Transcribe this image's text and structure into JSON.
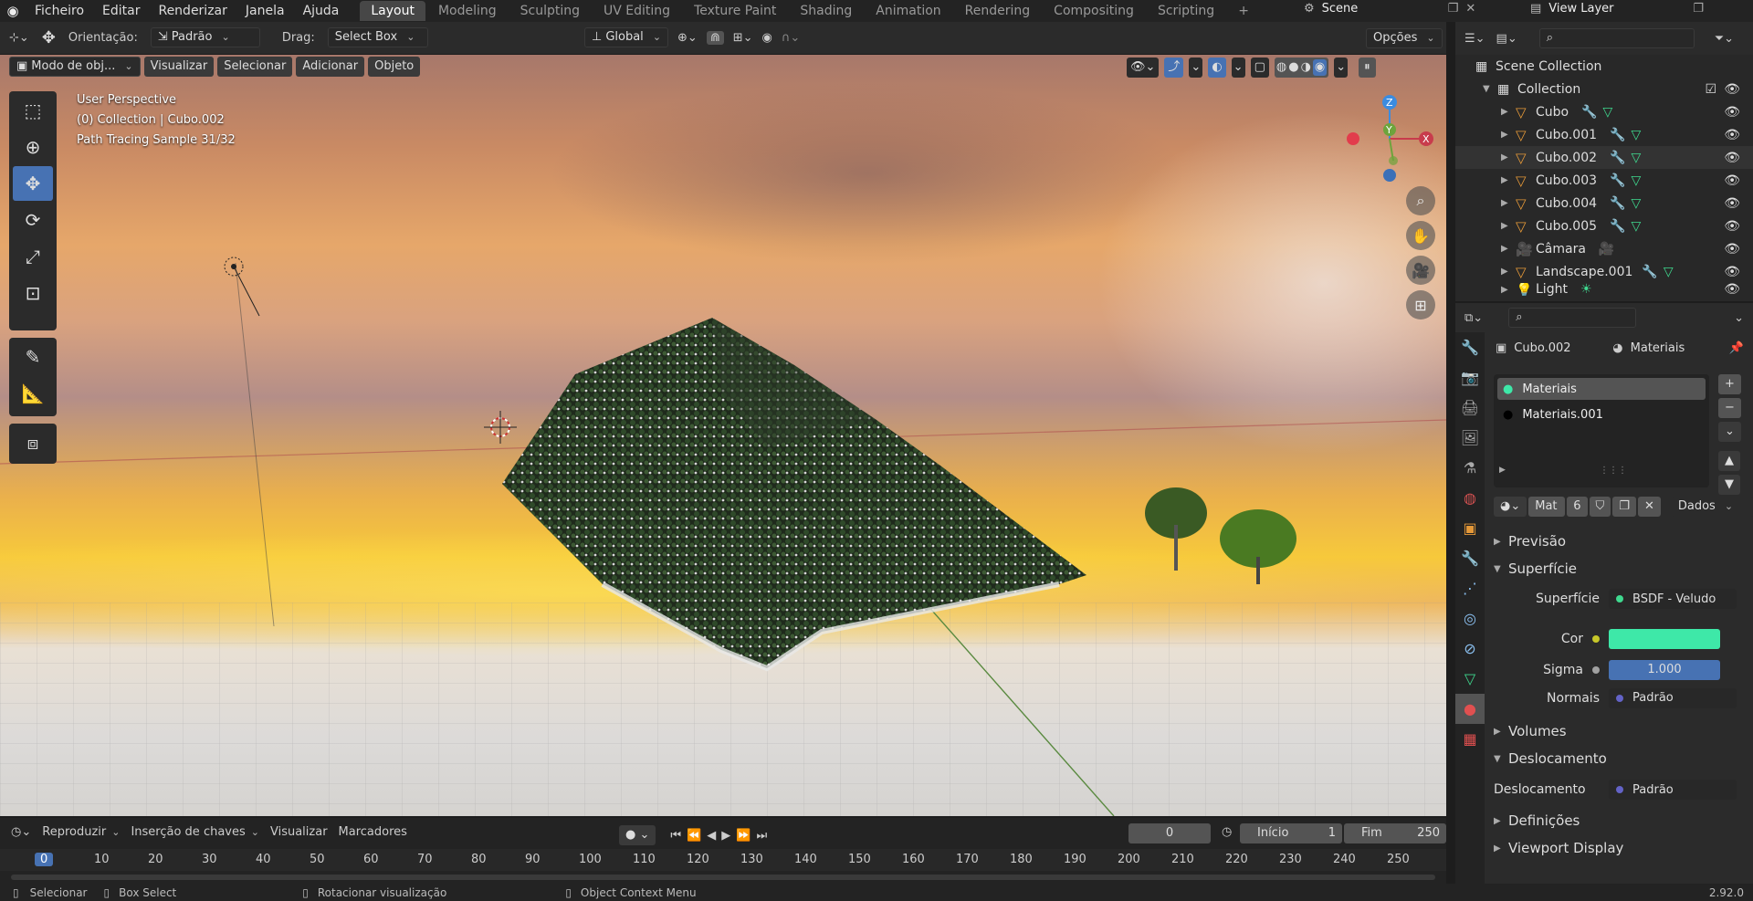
{
  "topbar": {
    "menus": [
      "Ficheiro",
      "Editar",
      "Renderizar",
      "Janela",
      "Ajuda"
    ],
    "workspaces": [
      "Layout",
      "Modeling",
      "Sculpting",
      "UV Editing",
      "Texture Paint",
      "Shading",
      "Animation",
      "Rendering",
      "Compositing",
      "Scripting"
    ],
    "active_workspace": "Layout",
    "add_tab": "+",
    "scene": "Scene",
    "view_layer": "View Layer"
  },
  "vp_header": {
    "orientation_label": "Orientação:",
    "orientation_value": "Padrão",
    "drag_label": "Drag:",
    "drag_value": "Select Box",
    "transform_orientation": "Global",
    "options": "Opções"
  },
  "vp_menu": {
    "mode": "Modo de obj...",
    "items": [
      "Visualizar",
      "Selecionar",
      "Adicionar",
      "Objeto"
    ]
  },
  "viewport": {
    "perspective": "User Perspective",
    "collection_info": "(0) Collection | Cubo.002",
    "sample_info": "Path Tracing Sample 31/32",
    "gizmo": {
      "x": "X",
      "y": "Y",
      "z": "Z"
    }
  },
  "outliner": {
    "root": "Scene Collection",
    "collection": "Collection",
    "items": [
      "Cubo",
      "Cubo.001",
      "Cubo.002",
      "Cubo.003",
      "Cubo.004",
      "Cubo.005",
      "Câmara",
      "Landscape.001",
      "Light"
    ],
    "selected": "Cubo.002"
  },
  "properties": {
    "object": "Cubo.002",
    "tab": "Materiais",
    "slots": [
      "Materiais",
      "Materiais.001"
    ],
    "mat_name": "Mat",
    "mat_users": "6",
    "link": "Dados",
    "sections": {
      "preview": "Previsão",
      "surface": "Superfície",
      "volumes": "Volumes",
      "displacement": "Deslocamento",
      "settings": "Definições",
      "viewport_display": "Viewport Display"
    },
    "surface_label": "Superfície",
    "surface_value": "BSDF - Veludo",
    "color_label": "Cor",
    "color_value": "#3ee8a8",
    "sigma_label": "Sigma",
    "sigma_value": "1.000",
    "normals_label": "Normais",
    "normals_value": "Padrão",
    "disp_label": "Deslocamento",
    "disp_value": "Padrão"
  },
  "timeline": {
    "menus": [
      "Reproduzir",
      "Inserção de chaves",
      "Visualizar",
      "Marcadores"
    ],
    "current_frame": "0",
    "start_label": "Início",
    "start_value": "1",
    "end_label": "Fim",
    "end_value": "250",
    "ticks": [
      "0",
      "10",
      "20",
      "30",
      "40",
      "50",
      "60",
      "70",
      "80",
      "90",
      "100",
      "110",
      "120",
      "130",
      "140",
      "150",
      "160",
      "170",
      "180",
      "190",
      "200",
      "210",
      "220",
      "230",
      "240",
      "250"
    ]
  },
  "status": {
    "select": "Selecionar",
    "box_select": "Box Select",
    "rotate": "Rotacionar visualização",
    "context": "Object Context Menu",
    "version": "2.92.0"
  }
}
